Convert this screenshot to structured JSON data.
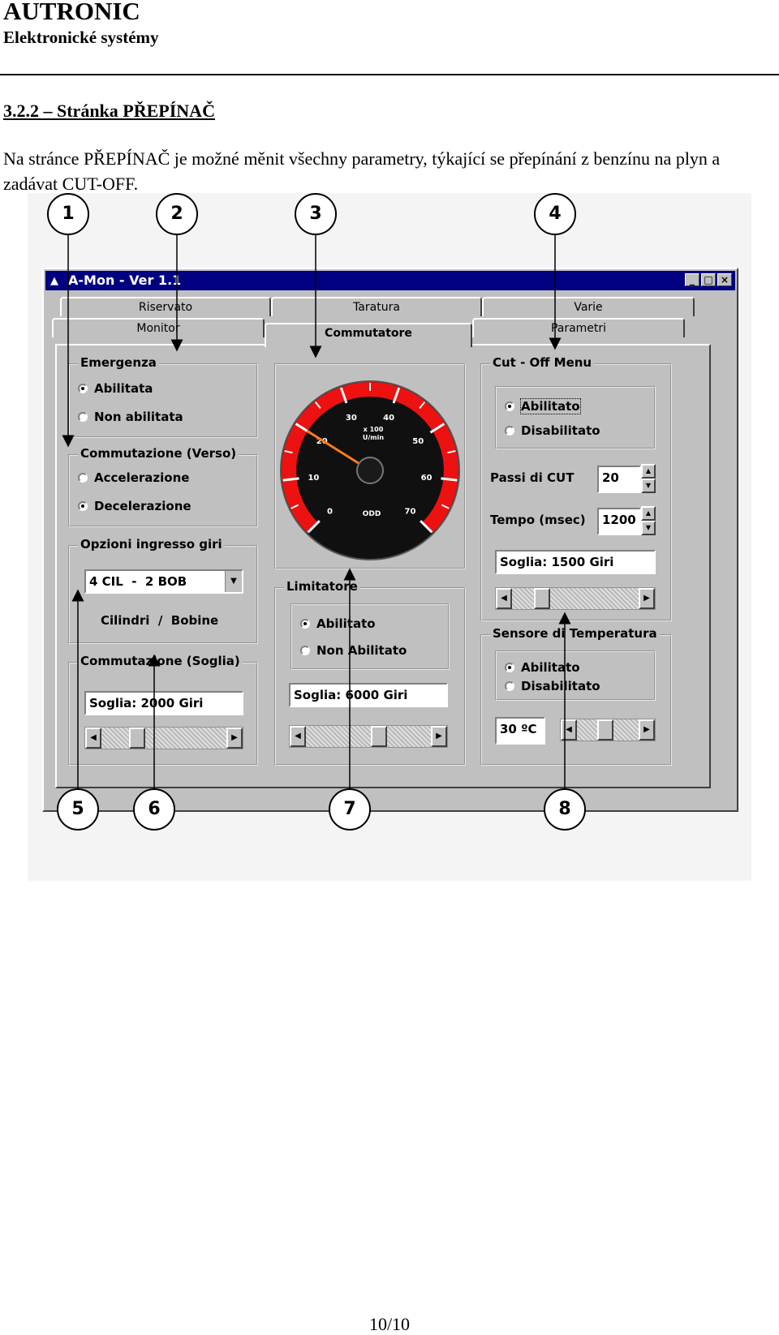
{
  "header": {
    "company": "AUTRONIC",
    "subtitle": "Elektronické systémy"
  },
  "section_title": "3.2.2 – Stránka PŘEPÍNAČ",
  "paragraph": "Na stránce PŘEPÍNAČ je možné měnit všechny parametry, týkající se přepínání z benzínu na plyn a zadávat CUT-OFF.",
  "figure": {
    "callouts": [
      "1",
      "2",
      "3",
      "4",
      "5",
      "6",
      "7",
      "8"
    ],
    "window": {
      "title": "A-Mon - Ver 1.1",
      "buttons": {
        "minimize": "_",
        "maximize": "□",
        "close": "×"
      },
      "tabs_back": [
        "Riservato",
        "Taratura",
        "Varie"
      ],
      "tabs_front": [
        "Monitor",
        "Commutatore",
        "Parametri"
      ],
      "emergenza": {
        "label": "Emergenza",
        "options": [
          "Abilitata",
          "Non abilitata"
        ],
        "selected": 0
      },
      "commutazione_verso": {
        "label": "Commutazione (Verso)",
        "options": [
          "Accelerazione",
          "Decelerazione"
        ],
        "selected": 1
      },
      "opzioni_giri": {
        "label": "Opzioni ingresso giri",
        "select_value": "4 CIL  -  2 BOB",
        "caption": "Cilindri  /  Bobine"
      },
      "commutazione_soglia": {
        "label": "Commutazione (Soglia)",
        "value": "Soglia: 2000 Giri",
        "slider_fraction": 0.25
      },
      "gauge": {
        "ticks": [
          "0",
          "10",
          "20",
          "30",
          "40",
          "50",
          "60",
          "70"
        ],
        "unit_line1": "x 100",
        "unit_line2": "U/min",
        "badge": "ODD",
        "needle_value": 20,
        "red_zone_from": 0,
        "max": 70
      },
      "limitatore": {
        "label": "Limitatore",
        "options": [
          "Abilitato",
          "Non Abilitato"
        ],
        "selected": 0,
        "value": "Soglia: 6000 Giri",
        "slider_fraction": 0.6
      },
      "cutoff": {
        "label": "Cut - Off Menu",
        "options": [
          "Abilitato",
          "Disabilitato"
        ],
        "selected": 0,
        "passi_label": "Passi di CUT",
        "passi_value": "20",
        "tempo_label": "Tempo (msec)",
        "tempo_value": "1200",
        "soglia": "Soglia: 1500 Giri",
        "slider_fraction": 0.2
      },
      "sensore": {
        "label": "Sensore di Temperatura",
        "options": [
          "Abilitato",
          "Disabilitato"
        ],
        "selected": 0,
        "value": "30 ºC",
        "slider_fraction": 0.45
      }
    }
  },
  "page_number": "10/10"
}
